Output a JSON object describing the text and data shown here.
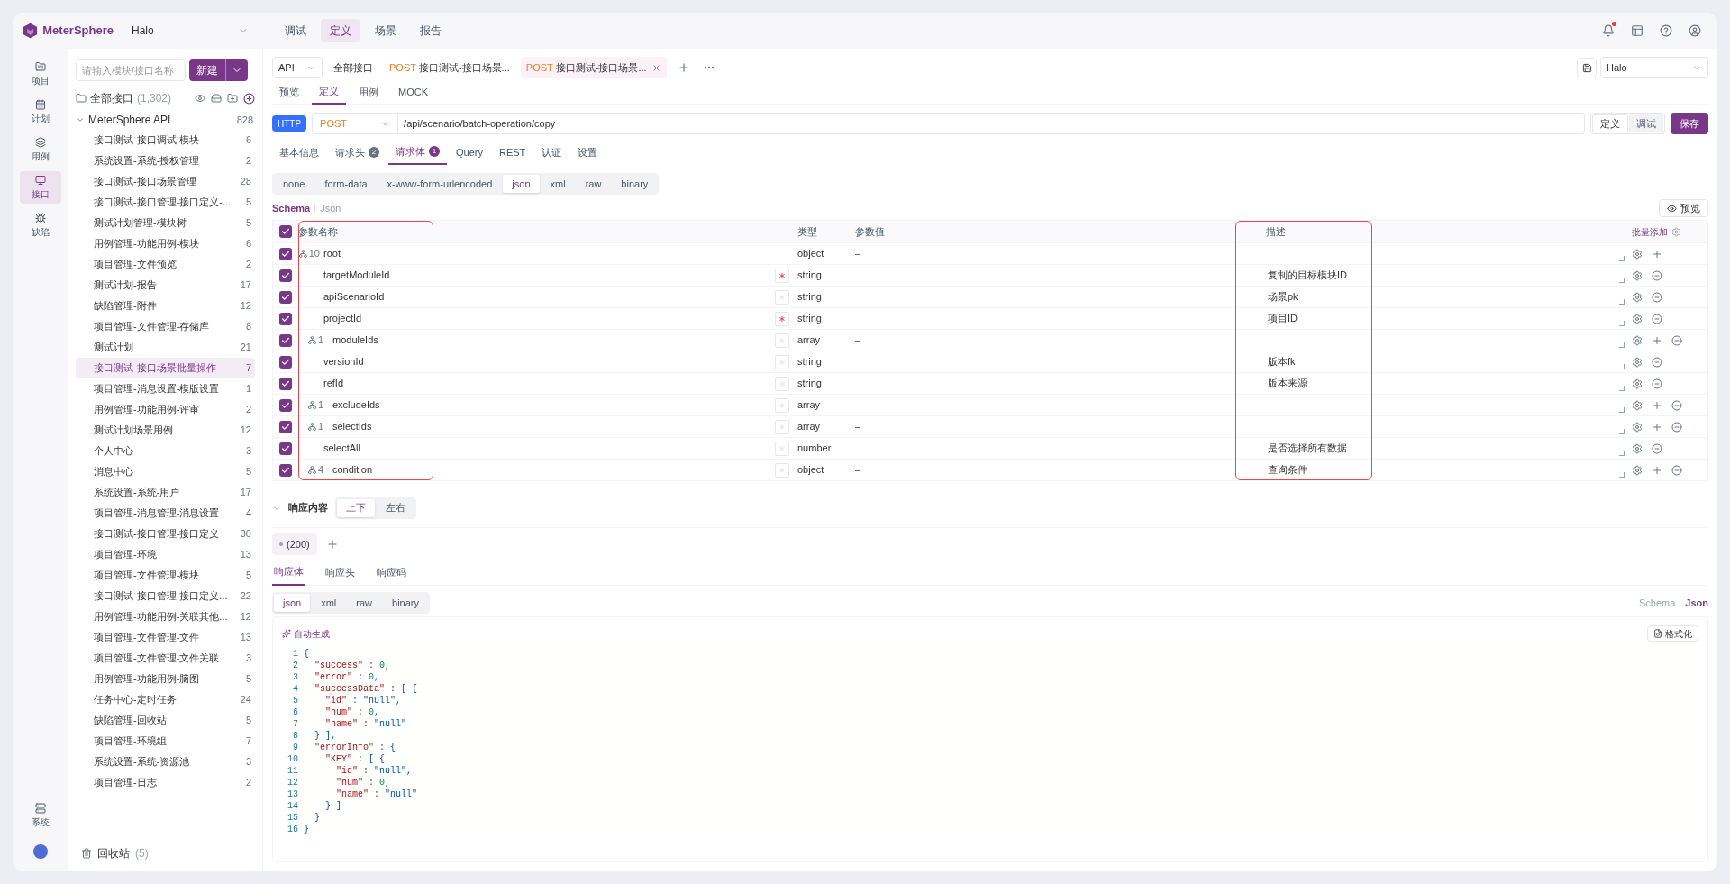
{
  "app": {
    "name": "MeterSphere",
    "project": "Halo",
    "unread": true
  },
  "top_nav": [
    {
      "label": "调试",
      "selected": false
    },
    {
      "label": "定义",
      "selected": true
    },
    {
      "label": "场景",
      "selected": false
    },
    {
      "label": "报告",
      "selected": false
    }
  ],
  "side_nav": [
    {
      "label": "项目",
      "selected": false
    },
    {
      "label": "计划",
      "selected": false
    },
    {
      "label": "用例",
      "selected": false
    },
    {
      "label": "接口",
      "selected": true
    },
    {
      "label": "缺陷",
      "selected": false
    }
  ],
  "system_nav": {
    "label": "系统"
  },
  "tree": {
    "search_placeholder": "请输入模块/接口名称",
    "new_button": "新建",
    "root_label": "全部接口",
    "root_count": "(1,302)",
    "groups": [
      {
        "label": "MeterSphere API",
        "count": "828",
        "expanded": true,
        "children": [
          {
            "label": "接口测试-接口调试-模块",
            "count": "6",
            "selected": false
          },
          {
            "label": "系统设置-系统-授权管理",
            "count": "2",
            "selected": false
          },
          {
            "label": "接口测试-接口场景管理",
            "count": "28",
            "selected": false
          },
          {
            "label": "接口测试-接口管理-接口定义-...",
            "count": "5",
            "selected": false
          },
          {
            "label": "测试计划管理-模块树",
            "count": "5",
            "selected": false
          },
          {
            "label": "用例管理-功能用例-模块",
            "count": "6",
            "selected": false
          },
          {
            "label": "项目管理-文件预览",
            "count": "2",
            "selected": false
          },
          {
            "label": "测试计划-报告",
            "count": "17",
            "selected": false
          },
          {
            "label": "缺陷管理-附件",
            "count": "12",
            "selected": false
          },
          {
            "label": "项目管理-文件管理-存储库",
            "count": "8",
            "selected": false
          },
          {
            "label": "测试计划",
            "count": "21",
            "selected": false
          },
          {
            "label": "接口测试-接口场景批量操作",
            "count": "7",
            "selected": true
          },
          {
            "label": "项目管理-消息设置-模版设置",
            "count": "1",
            "selected": false
          },
          {
            "label": "用例管理-功能用例-评审",
            "count": "2",
            "selected": false
          },
          {
            "label": "测试计划场景用例",
            "count": "12",
            "selected": false
          },
          {
            "label": "个人中心",
            "count": "3",
            "selected": false
          },
          {
            "label": "消息中心",
            "count": "5",
            "selected": false
          },
          {
            "label": "系统设置-系统-用户",
            "count": "17",
            "selected": false
          },
          {
            "label": "项目管理-消息管理-消息设置",
            "count": "4",
            "selected": false
          },
          {
            "label": "接口测试-接口管理-接口定义",
            "count": "30",
            "selected": false
          },
          {
            "label": "项目管理-环境",
            "count": "13",
            "selected": false
          },
          {
            "label": "项目管理-文件管理-模块",
            "count": "5",
            "selected": false
          },
          {
            "label": "接口测试-接口管理-接口定义...",
            "count": "22",
            "selected": false
          },
          {
            "label": "用例管理-功能用例-关联其他...",
            "count": "12",
            "selected": false
          },
          {
            "label": "项目管理-文件管理-文件",
            "count": "13",
            "selected": false
          },
          {
            "label": "项目管理-文件管理-文件关联",
            "count": "3",
            "selected": false
          },
          {
            "label": "用例管理-功能用例-脑图",
            "count": "5",
            "selected": false
          },
          {
            "label": "任务中心-定时任务",
            "count": "24",
            "selected": false
          },
          {
            "label": "缺陷管理-回收站",
            "count": "5",
            "selected": false
          },
          {
            "label": "项目管理-环境组",
            "count": "7",
            "selected": false
          },
          {
            "label": "系统设置-系统-资源池",
            "count": "3",
            "selected": false
          },
          {
            "label": "项目管理-日志",
            "count": "2",
            "selected": false
          }
        ]
      }
    ],
    "recycle": {
      "label": "回收站",
      "count": "(5)"
    }
  },
  "tabs_bar": {
    "protocol": "API",
    "tabs": [
      {
        "label": "全部接口",
        "selected": false
      },
      {
        "method": "POST",
        "label": "接口测试-接口场景...",
        "selected": false
      },
      {
        "method": "POST",
        "label": "接口测试-接口场景...",
        "selected": true
      }
    ],
    "environment": "Halo"
  },
  "sub_tabs": [
    {
      "label": "预览",
      "selected": false
    },
    {
      "label": "定义",
      "selected": true
    },
    {
      "label": "用例",
      "selected": false
    },
    {
      "label": "MOCK",
      "selected": false
    }
  ],
  "request": {
    "protocol": "HTTP",
    "method": "POST",
    "url": "/api/scenario/batch-operation/copy",
    "modes": [
      {
        "label": "定义",
        "selected": true
      },
      {
        "label": "调试",
        "selected": false
      }
    ],
    "save": "保存"
  },
  "request_tabs": [
    {
      "label": "基本信息",
      "selected": false
    },
    {
      "label": "请求头",
      "count": "2",
      "selected": false
    },
    {
      "label": "请求体",
      "count": "1",
      "selected": true
    },
    {
      "label": "Query",
      "selected": false
    },
    {
      "label": "REST",
      "selected": false
    },
    {
      "label": "认证",
      "selected": false
    },
    {
      "label": "设置",
      "selected": false
    }
  ],
  "body_types": [
    {
      "label": "none",
      "selected": false
    },
    {
      "label": "form-data",
      "selected": false
    },
    {
      "label": "x-www-form-urlencoded",
      "selected": false
    },
    {
      "label": "json",
      "selected": true
    },
    {
      "label": "xml",
      "selected": false
    },
    {
      "label": "raw",
      "selected": false
    },
    {
      "label": "binary",
      "selected": false
    }
  ],
  "schema_views": [
    {
      "label": "Schema",
      "selected": true
    },
    {
      "label": "Json",
      "selected": false
    }
  ],
  "preview_button": "预览",
  "params": {
    "all_checked": true,
    "batch_add": "批量添加",
    "columns": [
      {
        "label": "参数名称",
        "highlighted": true
      },
      {
        "label": "类型",
        "highlighted": false
      },
      {
        "label": "参数值",
        "highlighted": false
      },
      {
        "label": "描述",
        "highlighted": true
      }
    ],
    "rows": [
      {
        "name": "root",
        "child_count": "10",
        "type": "object",
        "value": "–",
        "checked": true,
        "children": [
          {
            "name": "targetModuleId",
            "required": true,
            "type": "string",
            "description": "复制的目标模块ID",
            "checked": true
          },
          {
            "name": "apiScenarioId",
            "required": false,
            "type": "string",
            "description": "场景pk",
            "checked": true
          },
          {
            "name": "projectId",
            "required": true,
            "type": "string",
            "description": "项目ID",
            "checked": true
          },
          {
            "name": "moduleIds",
            "child_count": "1",
            "required": false,
            "type": "array",
            "value": "–",
            "checked": true
          },
          {
            "name": "versionId",
            "required": false,
            "type": "string",
            "description": "版本fk",
            "checked": true
          },
          {
            "name": "refId",
            "required": false,
            "type": "string",
            "description": "版本来源",
            "checked": true
          },
          {
            "name": "excludeIds",
            "child_count": "1",
            "required": false,
            "type": "array",
            "value": "–",
            "checked": true
          },
          {
            "name": "selectIds",
            "child_count": "1",
            "required": false,
            "type": "array",
            "value": "–",
            "checked": true
          },
          {
            "name": "selectAll",
            "required": false,
            "type": "number",
            "description": "是否选择所有数据",
            "checked": true
          },
          {
            "name": "condition",
            "child_count": "4",
            "required": false,
            "type": "object",
            "value": "–",
            "description": "查询条件",
            "checked": true
          }
        ]
      }
    ]
  },
  "response": {
    "title": "响应内容",
    "expanded": true,
    "layouts": [
      {
        "label": "上下",
        "selected": true
      },
      {
        "label": "左右",
        "selected": false
      }
    ],
    "status_tab": "(200)",
    "tabs": [
      {
        "label": "响应体",
        "selected": true
      },
      {
        "label": "响应头",
        "selected": false
      },
      {
        "label": "响应码",
        "selected": false
      }
    ],
    "body_types": [
      {
        "label": "json",
        "selected": true
      },
      {
        "label": "xml",
        "selected": false
      },
      {
        "label": "raw",
        "selected": false
      },
      {
        "label": "binary",
        "selected": false
      }
    ],
    "views": [
      {
        "label": "Schema",
        "selected": false
      },
      {
        "label": "Json",
        "selected": true
      }
    ],
    "auto_generate": "自动生成",
    "format_button": "格式化",
    "code": [
      {
        "no": "1",
        "text": "{"
      },
      {
        "no": "2",
        "text": "  \"success\" : 0,"
      },
      {
        "no": "3",
        "text": "  \"error\" : 0,"
      },
      {
        "no": "4",
        "text": "  \"successData\" : [ {"
      },
      {
        "no": "5",
        "text": "    \"id\" : \"null\","
      },
      {
        "no": "6",
        "text": "    \"num\" : 0,"
      },
      {
        "no": "7",
        "text": "    \"name\" : \"null\""
      },
      {
        "no": "8",
        "text": "  } ],"
      },
      {
        "no": "9",
        "text": "  \"errorInfo\" : {"
      },
      {
        "no": "10",
        "text": "    \"KEY\" : [ {"
      },
      {
        "no": "11",
        "text": "      \"id\" : \"null\","
      },
      {
        "no": "12",
        "text": "      \"num\" : 0,"
      },
      {
        "no": "13",
        "text": "      \"name\" : \"null\""
      },
      {
        "no": "14",
        "text": "    } ]"
      },
      {
        "no": "15",
        "text": "  }"
      },
      {
        "no": "16",
        "text": "}"
      }
    ]
  }
}
